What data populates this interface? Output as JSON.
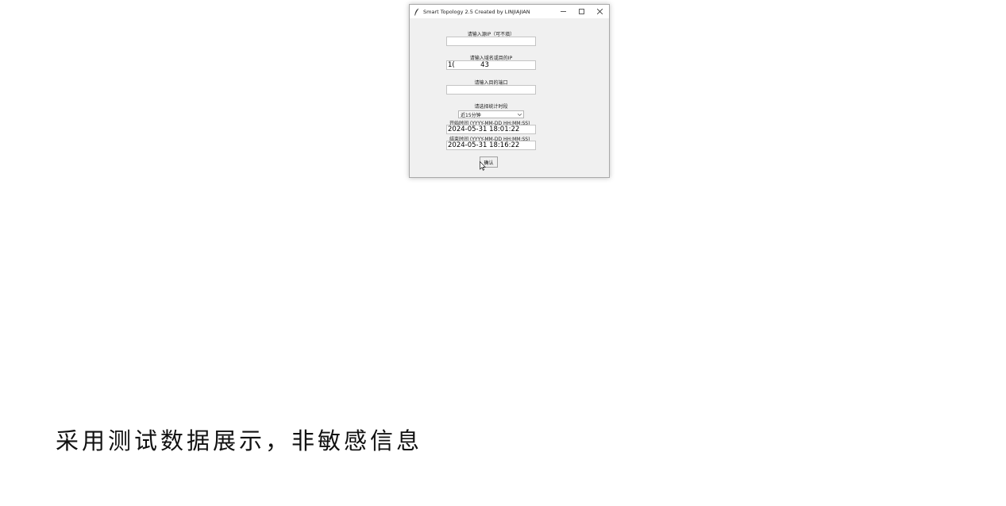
{
  "window": {
    "title": "Smart Topology 2.5 Created by LINJIAJIAN",
    "icons": {
      "app": "feather-icon",
      "minimize": "minimize-icon",
      "maximize": "maximize-icon",
      "close": "close-icon"
    }
  },
  "form": {
    "source_ip": {
      "label": "请输入源IP（可不填）",
      "value": ""
    },
    "target": {
      "label": "请输入域名或目的IP",
      "value": "1(            43"
    },
    "port": {
      "label": "请输入目的端口",
      "value": ""
    },
    "period": {
      "label": "请选择统计时段",
      "selected": "近15分钟"
    },
    "start_time": {
      "label": "开始时间 (YYYY-MM-DD HH:MM:SS)",
      "value": "2024-05-31 18:01:22"
    },
    "end_time": {
      "label": "结束时间 (YYYY-MM-DD HH:MM:SS)",
      "value": "2024-05-31 18:16:22"
    },
    "confirm_label": "确认"
  },
  "caption": "采用测试数据展示，非敏感信息"
}
